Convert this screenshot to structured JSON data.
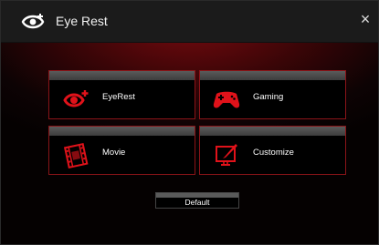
{
  "window": {
    "title": "Eye Rest",
    "close_symbol": "×"
  },
  "tiles": [
    {
      "id": "eyerest",
      "label": "EyeRest",
      "icon": "eye-icon"
    },
    {
      "id": "gaming",
      "label": "Gaming",
      "icon": "gamepad-icon"
    },
    {
      "id": "movie",
      "label": "Movie",
      "icon": "film-icon"
    },
    {
      "id": "customize",
      "label": "Customize",
      "icon": "paint-brush-icon"
    }
  ],
  "default_button": {
    "label": "Default"
  },
  "colors": {
    "accent": "#d8121a",
    "tile_border": "#8a1418",
    "titlebar": "#1b1b1b",
    "background_glow": "#7a0a0f"
  }
}
